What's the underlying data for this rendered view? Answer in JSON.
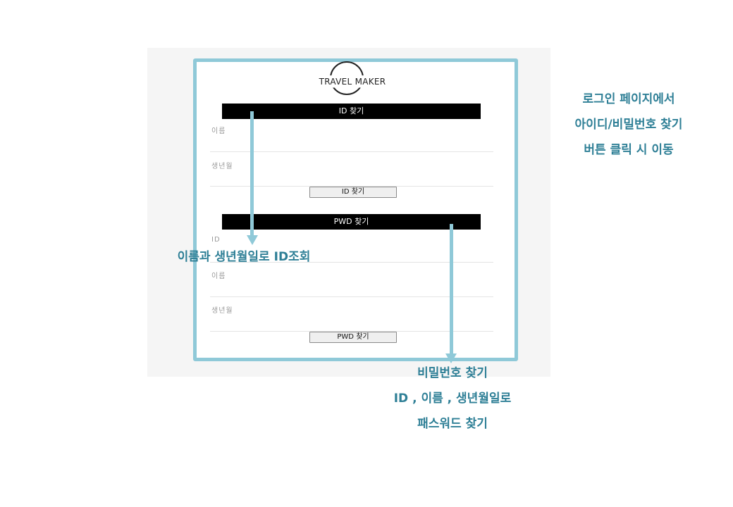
{
  "logo": {
    "text": "TRAVEL MAKER"
  },
  "id_find": {
    "header": "ID 찾기",
    "fields": [
      {
        "label": "이름"
      },
      {
        "label": "생년월"
      }
    ],
    "button": "ID 찾기"
  },
  "pwd_find": {
    "header": "PWD 찾기",
    "fields": [
      {
        "label": "ID"
      },
      {
        "label": "이름"
      },
      {
        "label": "생년월"
      }
    ],
    "button": "PWD 찾기"
  },
  "annotations": {
    "right": [
      "로그인 페이지에서",
      "아이디/비밀번호 찾기",
      "버튼 클릭 시 이동"
    ],
    "middle": "이름과 생년월일로 ID조회",
    "bottom": [
      "비밀번호 찾기",
      "ID , 이름 , 생년월일로",
      "패스워드 찾기"
    ]
  },
  "colors": {
    "accent": "#8fc9d8",
    "note_text": "#2e7f96",
    "bar": "#000000"
  }
}
